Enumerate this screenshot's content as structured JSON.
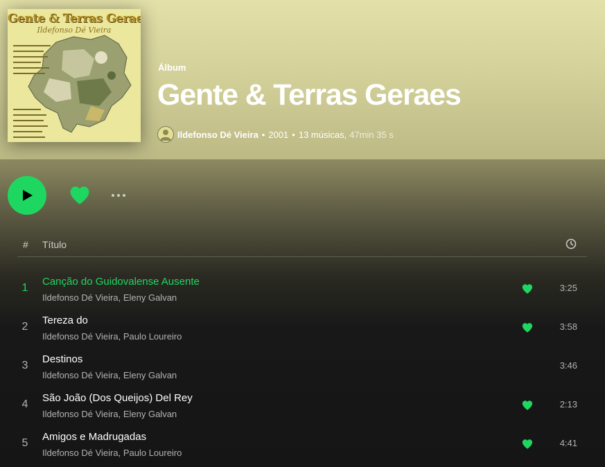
{
  "colors": {
    "accent": "#1ed760",
    "header_bg": "#d4d19a",
    "list_bg": "#121212"
  },
  "cover": {
    "title": "Gente & Terras Geraes",
    "subtitle": "Ildefonso Dé Vieira"
  },
  "album": {
    "kind": "Álbum",
    "title": "Gente & Terras Geraes",
    "artist": "Ildefonso Dé Vieira",
    "year": "2001",
    "tracks_count": "13 músicas,",
    "duration": "47min 35 s",
    "separator": "•"
  },
  "controls": {
    "play_icon": "play-icon",
    "like_icon": "heart-icon",
    "more_icon": "more-icon"
  },
  "table": {
    "col_number": "#",
    "col_title": "Título",
    "col_duration_icon": "clock-icon"
  },
  "tracks": [
    {
      "number": "1",
      "title": "Canção do Guidovalense Ausente",
      "artists": "Ildefonso Dé Vieira, Eleny Galvan",
      "duration": "3:25",
      "liked": true,
      "playing": true
    },
    {
      "number": "2",
      "title": "Tereza do",
      "artists": "Ildefonso Dé Vieira, Paulo Loureiro",
      "duration": "3:58",
      "liked": true,
      "playing": false
    },
    {
      "number": "3",
      "title": "Destinos",
      "artists": "Ildefonso Dé Vieira, Eleny Galvan",
      "duration": "3:46",
      "liked": false,
      "playing": false
    },
    {
      "number": "4",
      "title": "São João (Dos Queijos) Del Rey",
      "artists": "Ildefonso Dé Vieira, Eleny Galvan",
      "duration": "2:13",
      "liked": true,
      "playing": false
    },
    {
      "number": "5",
      "title": "Amigos e Madrugadas",
      "artists": "Ildefonso Dé Vieira, Paulo Loureiro",
      "duration": "4:41",
      "liked": true,
      "playing": false
    }
  ]
}
